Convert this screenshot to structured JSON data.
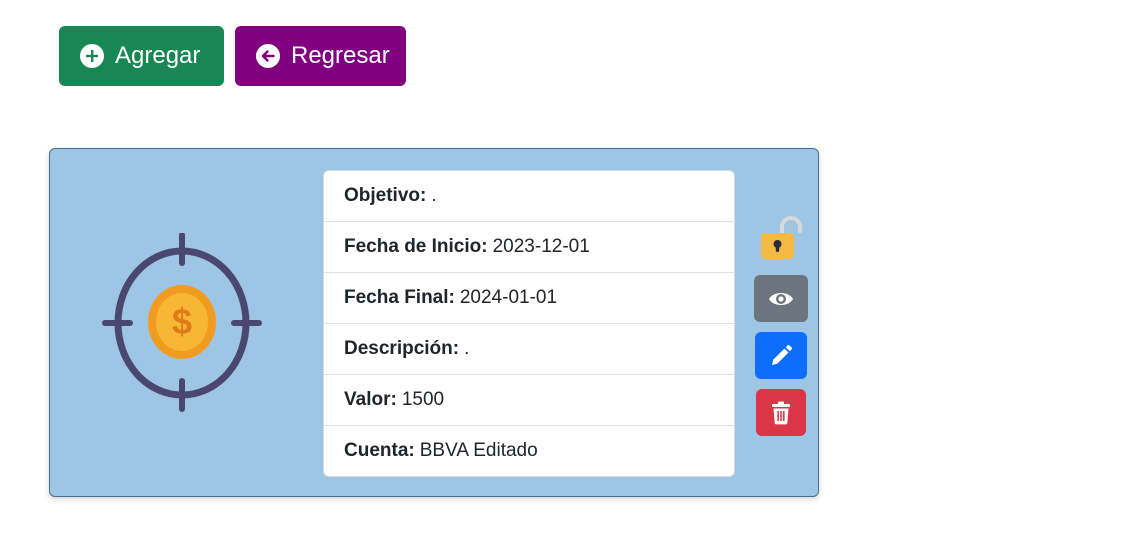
{
  "toolbar": {
    "add_label": "Agregar",
    "back_label": "Regresar"
  },
  "goal": {
    "fields": [
      {
        "label": "Objetivo:",
        "value": "."
      },
      {
        "label": "Fecha de Inicio:",
        "value": "2023-12-01"
      },
      {
        "label": "Fecha Final:",
        "value": "2024-01-01"
      },
      {
        "label": "Descripción:",
        "value": "."
      },
      {
        "label": "Valor:",
        "value": "1500"
      },
      {
        "label": "Cuenta:",
        "value": "BBVA Editado"
      }
    ]
  },
  "icons": {
    "add": "plus-circle-icon",
    "back": "arrow-left-circle-icon",
    "illustration": "target-coin-icon",
    "lock": "unlocked-padlock-icon",
    "view": "eye-icon",
    "edit": "pencil-icon",
    "delete": "trash-icon"
  },
  "colors": {
    "add_button": "#198754",
    "back_button": "#800080",
    "card_background": "#9ec5e4",
    "view_button": "#6c757d",
    "edit_button": "#0d6efd",
    "delete_button": "#dc3545",
    "lock": "#f4b942"
  }
}
